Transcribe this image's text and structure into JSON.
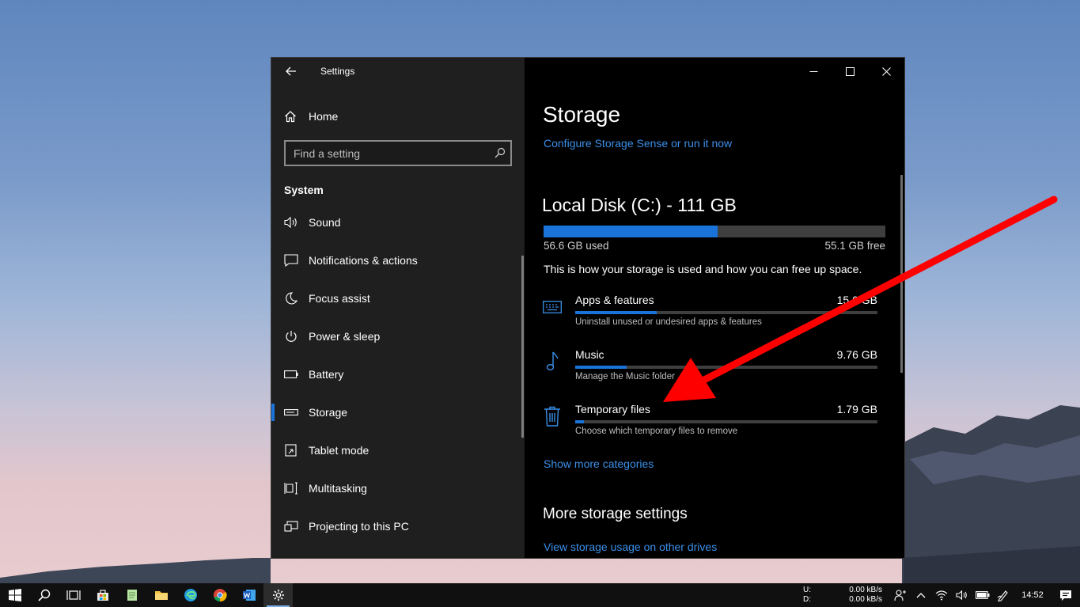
{
  "window": {
    "app_title": "Settings",
    "controls": {
      "minimize": "minimize-icon",
      "maximize": "maximize-icon",
      "close": "close-icon"
    }
  },
  "sidebar": {
    "home_label": "Home",
    "search_placeholder": "Find a setting",
    "section_title": "System",
    "items": [
      {
        "label": "Sound",
        "icon": "speaker-icon",
        "active": false
      },
      {
        "label": "Notifications & actions",
        "icon": "notification-icon",
        "active": false
      },
      {
        "label": "Focus assist",
        "icon": "moon-icon",
        "active": false
      },
      {
        "label": "Power & sleep",
        "icon": "power-icon",
        "active": false
      },
      {
        "label": "Battery",
        "icon": "battery-icon",
        "active": false
      },
      {
        "label": "Storage",
        "icon": "storage-icon",
        "active": true
      },
      {
        "label": "Tablet mode",
        "icon": "tablet-icon",
        "active": false
      },
      {
        "label": "Multitasking",
        "icon": "multitasking-icon",
        "active": false
      },
      {
        "label": "Projecting to this PC",
        "icon": "projecting-icon",
        "active": false
      }
    ]
  },
  "main": {
    "title": "Storage",
    "configure_link": "Configure Storage Sense or run it now",
    "disk": {
      "title": "Local Disk (C:) - 111 GB",
      "used_label": "56.6 GB used",
      "free_label": "55.1 GB free",
      "used_fraction": 0.51
    },
    "description": "This is how your storage is used and how you can free up space.",
    "categories": [
      {
        "name": "Apps & features",
        "size": "15.0 GB",
        "sub": "Uninstall unused or undesired apps & features",
        "fraction": 0.27,
        "icon": "keyboard-icon"
      },
      {
        "name": "Music",
        "size": "9.76 GB",
        "sub": "Manage the Music folder",
        "fraction": 0.17,
        "icon": "music-note-icon"
      },
      {
        "name": "Temporary files",
        "size": "1.79 GB",
        "sub": "Choose which temporary files to remove",
        "fraction": 0.03,
        "icon": "trash-icon"
      }
    ],
    "show_more_link": "Show more categories",
    "more_title": "More storage settings",
    "other_drives_link": "View storage usage on other drives"
  },
  "taskbar": {
    "net_labels": [
      "U:",
      "D:"
    ],
    "net_values": [
      "0.00 kB/s",
      "0.00 kB/s"
    ],
    "clock": "14:52"
  },
  "colors": {
    "accent": "#1a73d9",
    "link": "#3b8fe8",
    "annotation_arrow": "#ff0000"
  }
}
